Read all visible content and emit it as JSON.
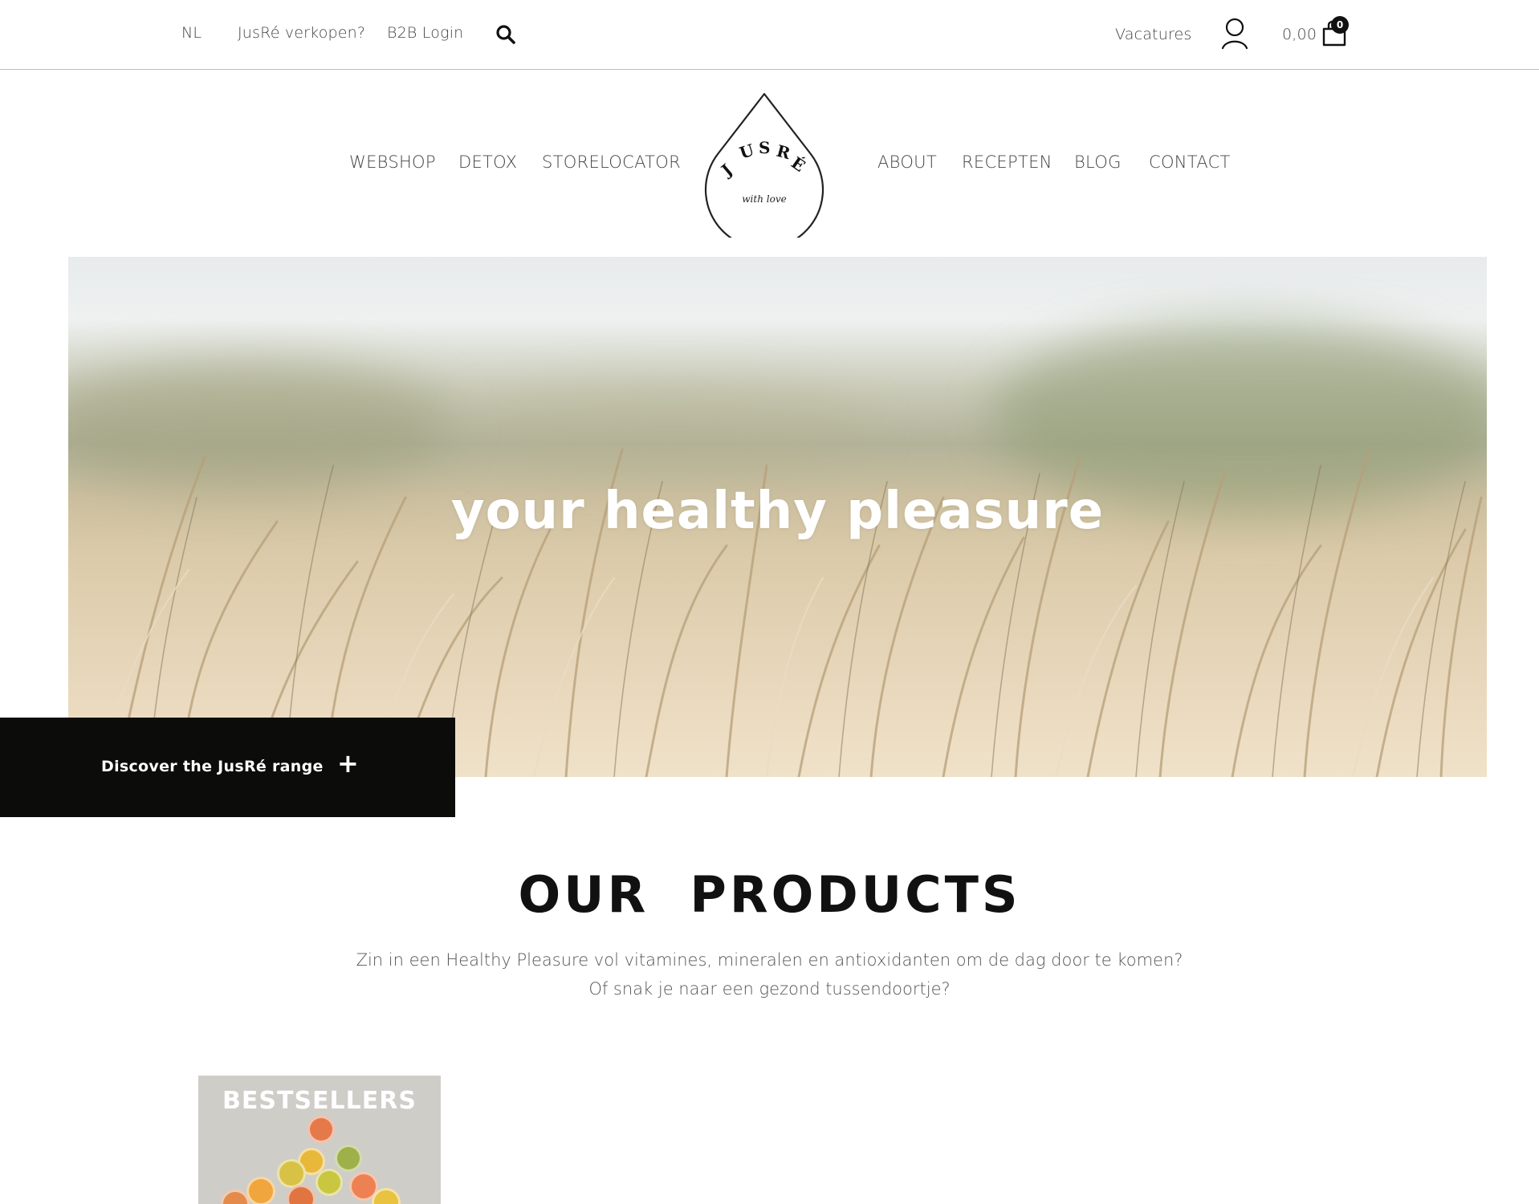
{
  "topbar": {
    "lang": "NL",
    "sell": "JusRé verkopen?",
    "b2b": "B2B Login",
    "vacatures": "Vacatures",
    "cart_total": "0,00",
    "cart_count": "0"
  },
  "nav": {
    "left": [
      "WEBSHOP",
      "DETOX",
      "STORELOCATOR"
    ],
    "right": [
      "ABOUT",
      "RECEPTEN",
      "BLOG",
      "CONTACT"
    ]
  },
  "logo": {
    "brand": "JUSRÉ",
    "tagline": "with love"
  },
  "hero": {
    "title": "your healthy pleasure"
  },
  "discover": {
    "label": "Discover the JusRé range",
    "plus": "+"
  },
  "products": {
    "title": "OUR  PRODUCTS",
    "line1": "Zin in een Healthy Pleasure vol vitamines, mineralen en antioxidanten om de dag door te komen?",
    "line2": "Of snak je naar een gezond tussendoortje?"
  },
  "cards": [
    {
      "label": "BESTSELLERS"
    }
  ],
  "icons": {
    "search": "search-icon",
    "user": "user-icon",
    "cart": "shopping-bag-icon",
    "plus": "plus-icon"
  }
}
